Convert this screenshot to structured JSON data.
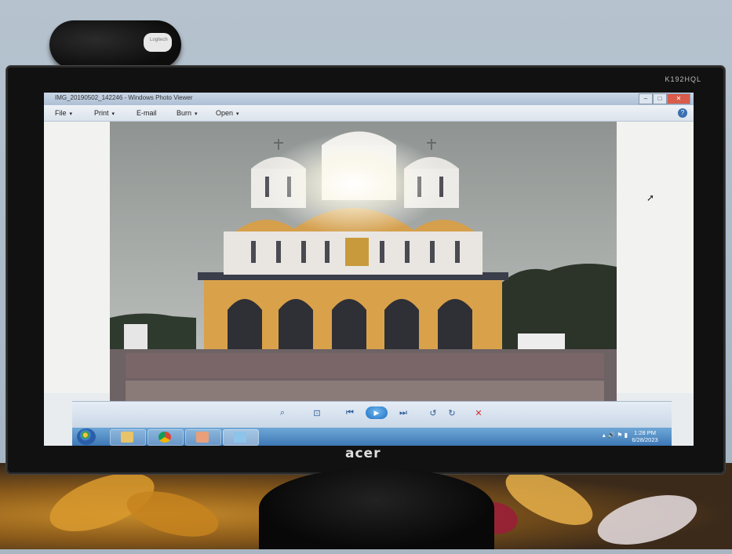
{
  "monitor": {
    "model": "K192HQL",
    "brand": "acer"
  },
  "webcam": {
    "logo_text": "Logitech"
  },
  "window": {
    "title": "IMG_20190502_142246 - Windows Photo Viewer",
    "controls": {
      "minimize": "–",
      "maximize": "□",
      "close": "✕"
    }
  },
  "menu": {
    "items": [
      {
        "label": "File",
        "caret": "▾"
      },
      {
        "label": "Print",
        "caret": "▾"
      },
      {
        "label": "E-mail",
        "caret": ""
      },
      {
        "label": "Burn",
        "caret": "▾"
      },
      {
        "label": "Open",
        "caret": "▾"
      }
    ],
    "help": "?"
  },
  "viewer": {
    "controls": {
      "zoom": "⌕",
      "actual_size": "⊡",
      "previous": "⏮",
      "slideshow": "▶",
      "next": "⏭",
      "rotate_ccw": "↺",
      "rotate_cw": "↻",
      "delete": "✕"
    }
  },
  "taskbar": {
    "apps": [
      "windows-explorer",
      "google-chrome",
      "paint",
      "photo-viewer"
    ],
    "tray": "▴  🔊  ⚑  ▮",
    "time": "1:28 PM",
    "date": "6/28/2023"
  },
  "colors": {
    "taskbar": "#3d78b6",
    "accent": "#2d5d9a",
    "close": "#d95b4a"
  }
}
